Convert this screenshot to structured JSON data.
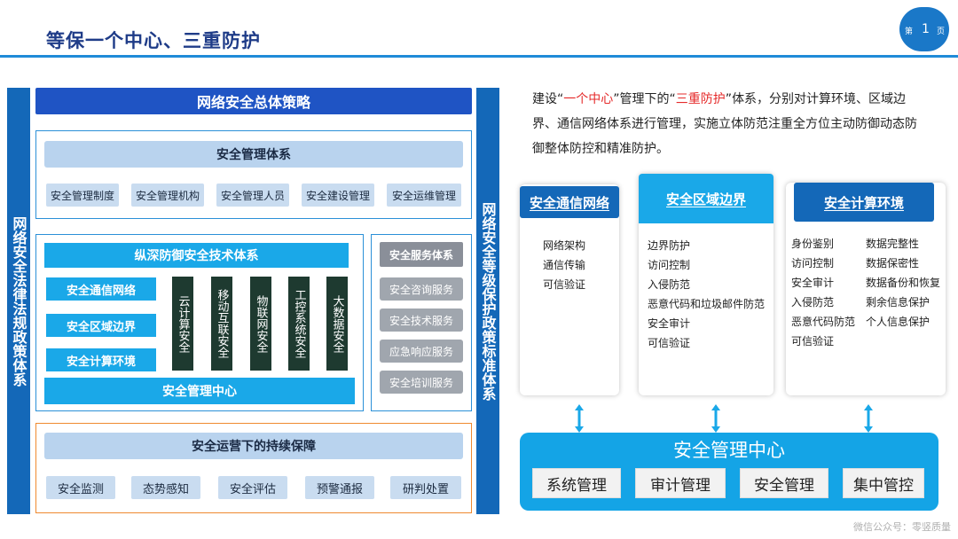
{
  "header": {
    "title": "等保一个中心、三重防护",
    "page_prefix": "第",
    "page_number": "1",
    "page_suffix": "页"
  },
  "left_pillar": "网络安全法律法规政策体系",
  "right_pillar": "网络安全等级保护政策标准体系",
  "top_strategy": "网络安全总体策略",
  "management_system": {
    "title": "安全管理体系",
    "items": [
      "安全管理制度",
      "安全管理机构",
      "安全管理人员",
      "安全建设管理",
      "安全运维管理"
    ]
  },
  "tech_system": {
    "title": "纵深防御安全技术体系",
    "left_items": [
      "安全通信网络",
      "安全区域边界",
      "安全计算环境"
    ],
    "columns": [
      "云计算安全",
      "移动互联安全",
      "物联网安全",
      "工控系统安全",
      "大数据安全"
    ],
    "center": "安全管理中心"
  },
  "service_system": {
    "title": "安全服务体系",
    "items": [
      "安全咨询服务",
      "安全技术服务",
      "应急响应服务",
      "安全培训服务"
    ]
  },
  "operations": {
    "title": "安全运营下的持续保障",
    "items": [
      "安全监测",
      "态势感知",
      "安全评估",
      "预警通报",
      "研判处置"
    ]
  },
  "intro": {
    "p1": "建设",
    "q1_open": "“",
    "hl1": "一个中心",
    "q1_close": "”",
    "p2": "管理下的",
    "q2_open": "“",
    "hl2": "三重防护",
    "q2_close": "”",
    "p3": "体系，分别对计算环境、区域边界、通信网络体系进行管理，实施立体防范注重全方位主动防御动态防御整体防控和精准防护。"
  },
  "cards": {
    "network": {
      "title": "安全通信网络",
      "items": [
        "网络架构",
        "通信传输",
        "可信验证"
      ]
    },
    "boundary": {
      "title": "安全区域边界",
      "items": [
        "边界防护",
        "访问控制",
        "入侵防范",
        "恶意代码和垃圾邮件防范",
        "安全审计",
        "可信验证"
      ]
    },
    "compute": {
      "title": "安全计算环境",
      "col1": [
        "身份鉴别",
        "访问控制",
        "安全审计",
        "入侵防范",
        "恶意代码防范",
        "可信验证"
      ],
      "col2": [
        "数据完整性",
        "数据保密性",
        "数据备份和恢复",
        "剩余信息保护",
        "个人信息保护"
      ]
    }
  },
  "management_center": {
    "title": "安全管理中心",
    "items": [
      "系统管理",
      "审计管理",
      "安全管理",
      "集中管控"
    ]
  },
  "watermark": "微信公众号：零竖质量",
  "colors": {
    "primary_blue": "#1468b8",
    "cyan": "#1aa8e8",
    "highlight_red": "#e52b2b",
    "orange_border": "#ef8a30",
    "dark_green": "#1e3a30"
  }
}
